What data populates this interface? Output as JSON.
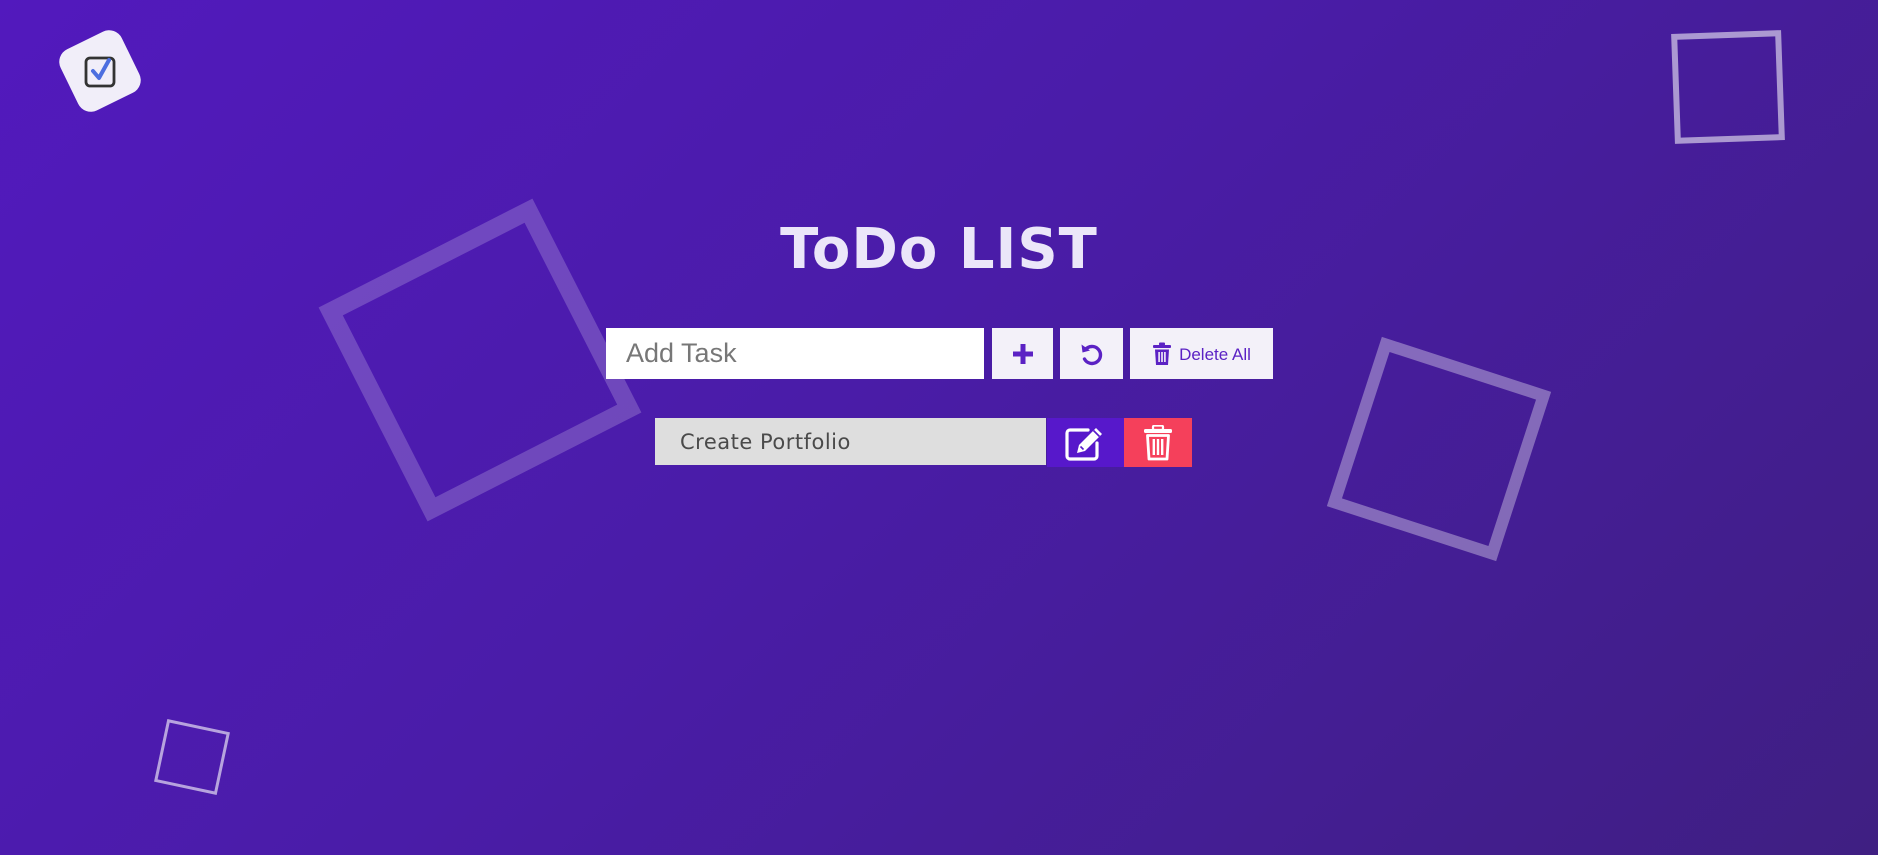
{
  "app": {
    "title": "ToDo LIST"
  },
  "input": {
    "placeholder": "Add Task",
    "value": ""
  },
  "toolbar": {
    "add_icon": "plus-icon",
    "reset_icon": "undo-icon",
    "delete_all_icon": "trash-icon",
    "delete_all_label": "Delete All"
  },
  "tasks": [
    {
      "text": "Create Portfolio",
      "edit_icon": "edit-icon",
      "delete_icon": "trash-icon"
    }
  ],
  "colors": {
    "background_start": "#5219bd",
    "background_end": "#3f1f82",
    "accent": "#5718cb",
    "danger": "#f5405b",
    "title_text": "#ebe6f9"
  }
}
